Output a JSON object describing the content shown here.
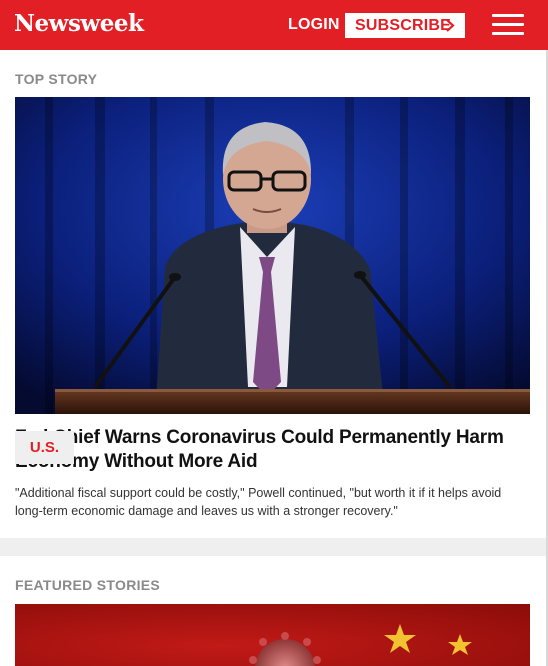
{
  "header": {
    "logo": "Newsweek",
    "login_label": "LOGIN",
    "subscribe_label": "SUBSCRIBE",
    "brand_color": "#e31f26"
  },
  "top_story": {
    "section_label": "TOP STORY",
    "category": "U.S.",
    "headline": "Fed Chief Warns Coronavirus Could Permanently Harm Economy Without More Aid",
    "summary": "\"Additional fiscal support could be costly,\" Powell continued, \"but worth it if it helps avoid long-term economic damage and leaves us with a stronger recovery.\""
  },
  "featured": {
    "section_label": "FEATURED STORIES"
  }
}
